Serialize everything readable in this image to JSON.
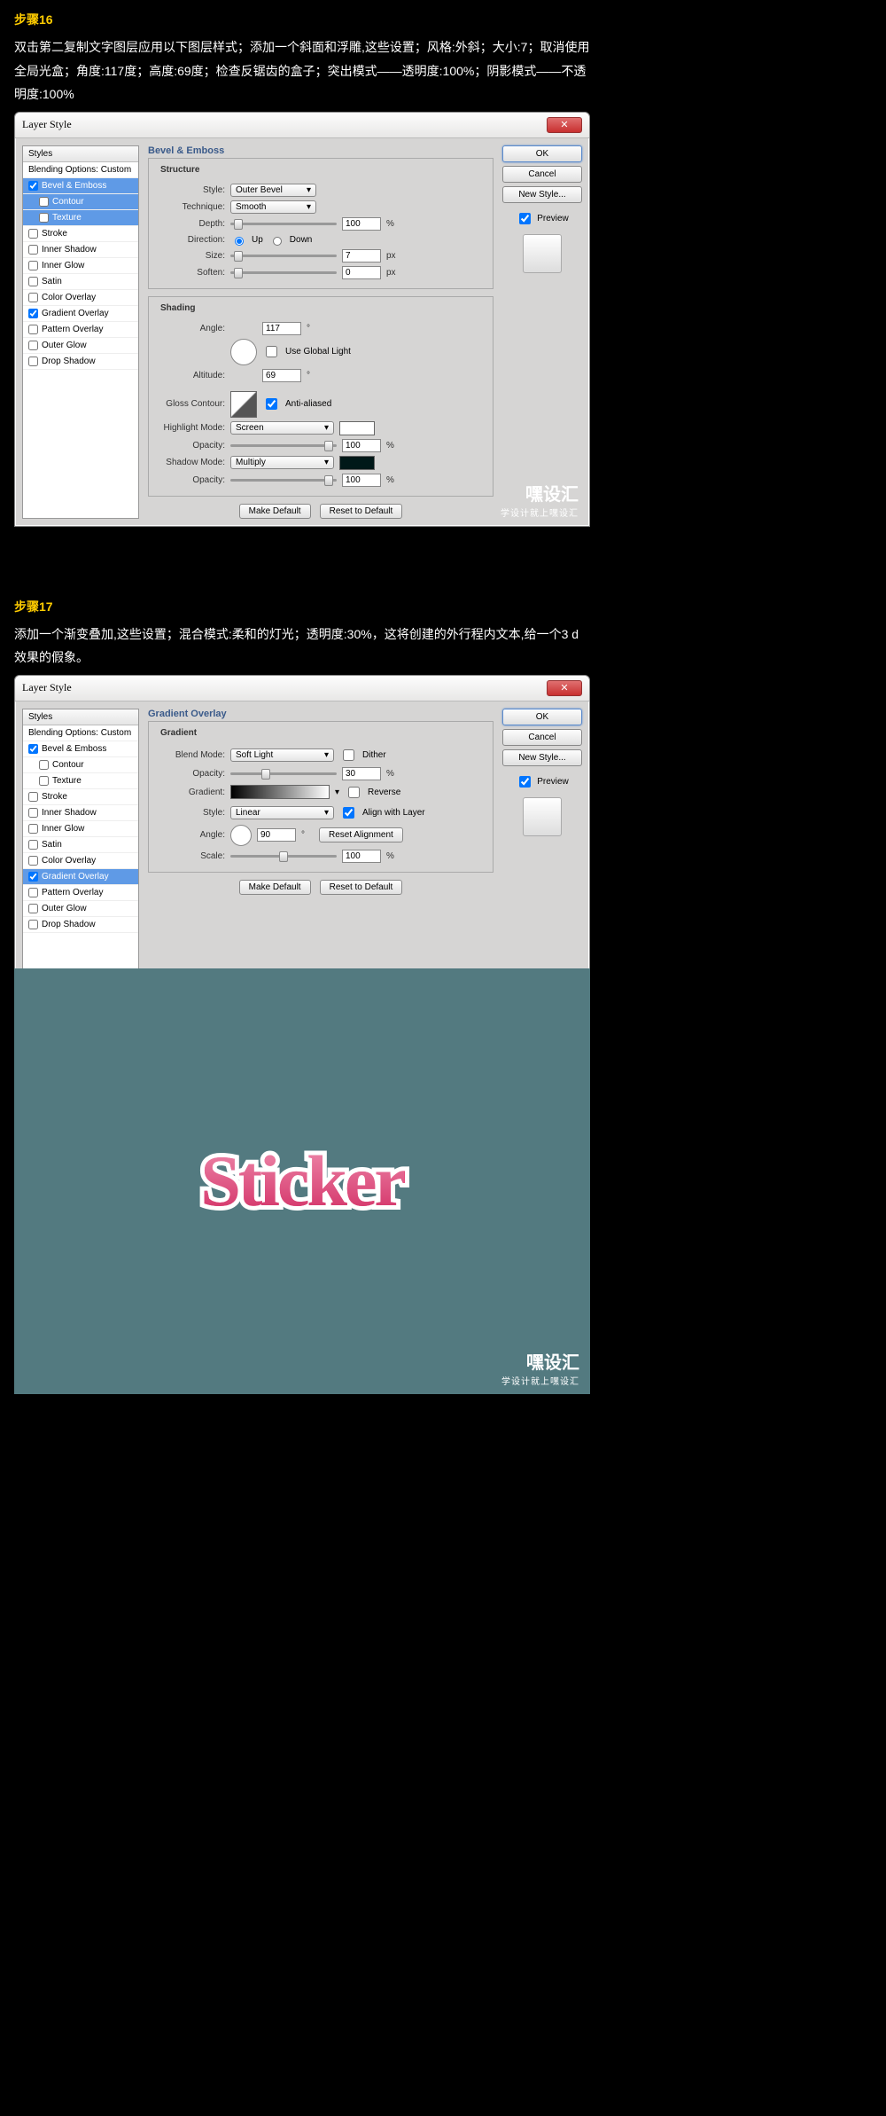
{
  "step16": {
    "title": "步骤16",
    "text": "双击第二复制文字图层应用以下图层样式；添加一个斜面和浮雕,这些设置；风格:外斜；大小:7；取消使用全局光盒；角度:117度；高度:69度；检查反锯齿的盒子；突出模式——透明度:100%；阴影模式——不透明度:100%"
  },
  "step17": {
    "title": "步骤17",
    "text": "添加一个渐变叠加,这些设置；混合模式:柔和的灯光；透明度:30%，这将创建的外行程内文本,给一个3 d效果的假象。"
  },
  "dialog": {
    "title": "Layer Style",
    "close": "✕"
  },
  "styles": {
    "header": "Styles",
    "blending": "Blending Options: Custom",
    "items": [
      "Bevel & Emboss",
      "Contour",
      "Texture",
      "Stroke",
      "Inner Shadow",
      "Inner Glow",
      "Satin",
      "Color Overlay",
      "Gradient Overlay",
      "Pattern Overlay",
      "Outer Glow",
      "Drop Shadow"
    ]
  },
  "bevel": {
    "heading": "Bevel & Emboss",
    "structure": "Structure",
    "style_l": "Style:",
    "style_v": "Outer Bevel",
    "tech_l": "Technique:",
    "tech_v": "Smooth",
    "depth_l": "Depth:",
    "depth_v": "100",
    "pct": "%",
    "dir_l": "Direction:",
    "up": "Up",
    "down": "Down",
    "size_l": "Size:",
    "size_v": "7",
    "px": "px",
    "soften_l": "Soften:",
    "soften_v": "0",
    "shading": "Shading",
    "angle_l": "Angle:",
    "angle_v": "117",
    "deg": "°",
    "global": "Use Global Light",
    "alt_l": "Altitude:",
    "alt_v": "69",
    "gloss_l": "Gloss Contour:",
    "aa": "Anti-aliased",
    "hmode_l": "Highlight Mode:",
    "hmode_v": "Screen",
    "opac_l": "Opacity:",
    "hopac_v": "100",
    "smode_l": "Shadow Mode:",
    "smode_v": "Multiply",
    "sopac_v": "100"
  },
  "grad": {
    "heading": "Gradient Overlay",
    "sub": "Gradient",
    "blend_l": "Blend Mode:",
    "blend_v": "Soft Light",
    "dither": "Dither",
    "opac_l": "Opacity:",
    "opac_v": "30",
    "pct": "%",
    "grad_l": "Gradient:",
    "reverse": "Reverse",
    "style_l": "Style:",
    "style_v": "Linear",
    "align": "Align with Layer",
    "angle_l": "Angle:",
    "angle_v": "90",
    "deg": "°",
    "reset": "Reset Alignment",
    "scale_l": "Scale:",
    "scale_v": "100"
  },
  "buttons": {
    "make": "Make Default",
    "reset": "Reset to Default",
    "ok": "OK",
    "cancel": "Cancel",
    "new": "New Style...",
    "preview": "Preview"
  },
  "watermark": {
    "big": "嘿设汇",
    "small": "学设计就上嘿设汇"
  },
  "result": {
    "text": "Sticker"
  }
}
